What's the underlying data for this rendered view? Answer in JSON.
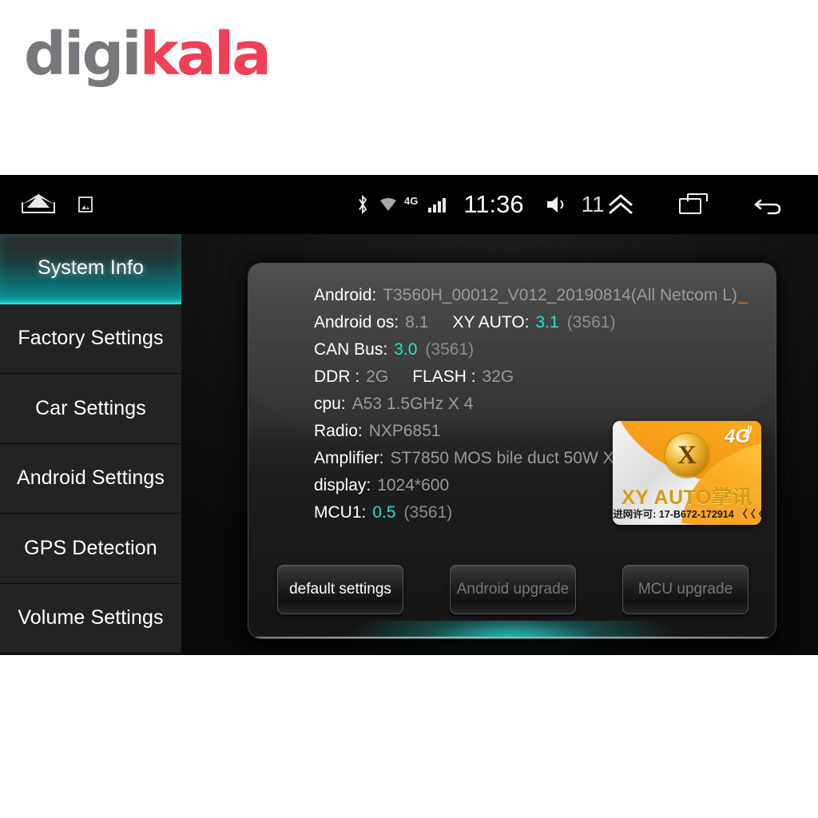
{
  "watermark": {
    "part1": "digi",
    "part2": "kala",
    "gray_color": "#77787b",
    "red_color": "#ef4056"
  },
  "statusbar": {
    "home_icon": "home-icon",
    "screenshot_icon": "screenshot-icon",
    "bluetooth_icon": "bluetooth-icon",
    "wifi_icon": "wifi-icon",
    "network_type": "4G",
    "signal_icon": "signal-bars-icon",
    "clock": "11:36",
    "speaker_icon": "volume-speaker-icon",
    "volume_level": "11",
    "chevron_up_icon": "double-chevron-up-icon",
    "recents_icon": "recent-apps-icon",
    "back_icon": "back-arrow-icon"
  },
  "sidebar": {
    "items": [
      {
        "label": "System Info",
        "active": true
      },
      {
        "label": "Factory Settings",
        "active": false
      },
      {
        "label": "Car Settings",
        "active": false
      },
      {
        "label": "Android Settings",
        "active": false
      },
      {
        "label": "GPS Detection",
        "active": false
      },
      {
        "label": "Volume Settings",
        "active": false
      }
    ],
    "active_accent": "#1ec8c8"
  },
  "info": {
    "android_key": "Android:",
    "android_value": "T3560H_00012_V012_20190814(All Netcom L)",
    "android_cursor": "_",
    "android_os_key": "Android os:",
    "android_os_value": "8.1",
    "xy_auto_key": "XY AUTO:",
    "xy_auto_value": "3.1",
    "xy_auto_build": "(3561)",
    "can_bus_key": "CAN Bus:",
    "can_bus_value": "3.0",
    "can_bus_build": "(3561)",
    "ddr_key": "DDR :",
    "ddr_value": "2G",
    "flash_key": "FLASH :",
    "flash_value": "32G",
    "cpu_key": "cpu:",
    "cpu_value": "A53 1.5GHz X 4",
    "radio_key": "Radio:",
    "radio_value": "NXP6851",
    "amplifier_key": "Amplifier:",
    "amplifier_value": "ST7850 MOS bile duct 50W X 4",
    "display_key": "display:",
    "display_value": "1024*600",
    "mcu1_key": "MCU1:",
    "mcu1_value": "0.5",
    "mcu1_build": "(3561)",
    "value_teal": "#1fe3cf",
    "value_gray": "#9a9a9a"
  },
  "badge": {
    "network": "4G",
    "logo_letter": "X",
    "title": "XY AUTO掌讯",
    "license": "进网许可: 17-B672-172914",
    "cc_mark": "〈〈〈",
    "gold_color": "#f9a31a"
  },
  "buttons": [
    {
      "label": "default settings",
      "disabled": false
    },
    {
      "label": "Android upgrade",
      "disabled": true
    },
    {
      "label": "MCU upgrade",
      "disabled": true
    }
  ]
}
